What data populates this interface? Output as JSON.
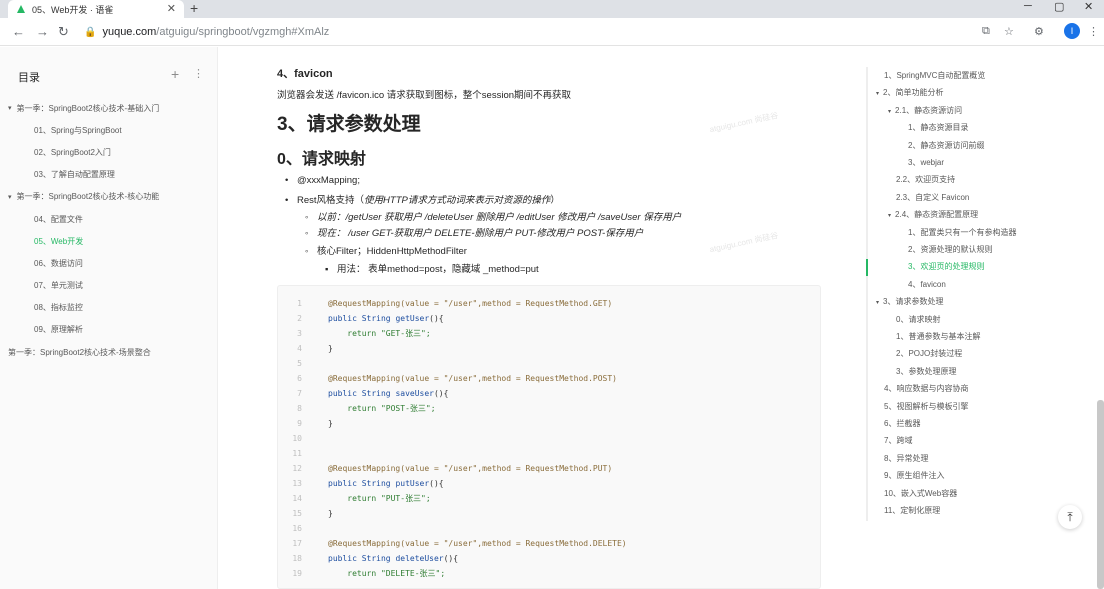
{
  "browser": {
    "tab_title": "05、Web开发 · 语雀",
    "tab_close": "✕",
    "new_tab": "+",
    "url_host": "yuque.com",
    "url_path": "/atguigu/springboot/vgzmgh#XmAlz",
    "profile_initial": "I"
  },
  "sidebar": {
    "title": "目录",
    "add": "+",
    "more": "⋮",
    "items": [
      {
        "label": "第一季：SpringBoot2核心技术-基础入门",
        "level": 1,
        "caret": "▾"
      },
      {
        "label": "01、Spring与SpringBoot",
        "level": 2
      },
      {
        "label": "02、SpringBoot2入门",
        "level": 2
      },
      {
        "label": "03、了解自动配置原理",
        "level": 2
      },
      {
        "label": "第一季：SpringBoot2核心技术-核心功能",
        "level": 1,
        "caret": "▾"
      },
      {
        "label": "04、配置文件",
        "level": 2
      },
      {
        "label": "05、Web开发",
        "level": 2,
        "active": true
      },
      {
        "label": "06、数据访问",
        "level": 2
      },
      {
        "label": "07、单元测试",
        "level": 2
      },
      {
        "label": "08、指标监控",
        "level": 2
      },
      {
        "label": "09、原理解析",
        "level": 2
      },
      {
        "label": "第一季：SpringBoot2核心技术-场景整合",
        "level": 1
      }
    ]
  },
  "content": {
    "favicon_heading": "4、favicon",
    "favicon_text": "浏览器会发送 /favicon.ico 请求获取到图标，整个session期间不再获取",
    "h2": "3、请求参数处理",
    "h3": "0、请求映射",
    "b1": "@xxxMapping;",
    "b2_prefix": "Rest风格支持（",
    "b2_italic": "使用HTTP请求方式动词来表示对资源的操作",
    "b2_suffix": "）",
    "s1": "以前：/getUser   获取用户     /deleteUser 删除用户    /editUser  修改用户       /saveUser 保存用户",
    "s2": "现在： /user    GET-获取用户    DELETE-删除用户     PUT-修改用户      POST-保存用户",
    "s3": "核心Filter；HiddenHttpMethodFilter",
    "ss1": "用法： 表单method=post，隐藏域 _method=put",
    "watermark": "atguigu.com 尚硅谷"
  },
  "code": [
    {
      "n": "1",
      "t": "ann",
      "text": "@RequestMapping(value = \"/user\",method = RequestMethod.GET)"
    },
    {
      "n": "2",
      "t": "sig",
      "kw": "public String ",
      "fn": "getUser",
      "rest": "(){"
    },
    {
      "n": "3",
      "t": "ret",
      "text": "    return \"GET-张三\";"
    },
    {
      "n": "4",
      "t": "pl",
      "text": "}"
    },
    {
      "n": "5",
      "t": "pl",
      "text": ""
    },
    {
      "n": "6",
      "t": "ann",
      "text": "@RequestMapping(value = \"/user\",method = RequestMethod.POST)"
    },
    {
      "n": "7",
      "t": "sig",
      "kw": "public String ",
      "fn": "saveUser",
      "rest": "(){"
    },
    {
      "n": "8",
      "t": "ret",
      "text": "    return \"POST-张三\";"
    },
    {
      "n": "9",
      "t": "pl",
      "text": "}"
    },
    {
      "n": "10",
      "t": "pl",
      "text": ""
    },
    {
      "n": "11",
      "t": "pl",
      "text": ""
    },
    {
      "n": "12",
      "t": "ann",
      "text": "@RequestMapping(value = \"/user\",method = RequestMethod.PUT)"
    },
    {
      "n": "13",
      "t": "sig",
      "kw": "public String ",
      "fn": "putUser",
      "rest": "(){"
    },
    {
      "n": "14",
      "t": "ret",
      "text": "    return \"PUT-张三\";"
    },
    {
      "n": "15",
      "t": "pl",
      "text": "}"
    },
    {
      "n": "16",
      "t": "pl",
      "text": ""
    },
    {
      "n": "17",
      "t": "ann",
      "text": "@RequestMapping(value = \"/user\",method = RequestMethod.DELETE)"
    },
    {
      "n": "18",
      "t": "sig",
      "kw": "public String ",
      "fn": "deleteUser",
      "rest": "(){"
    },
    {
      "n": "19",
      "t": "ret",
      "text": "    return \"DELETE-张三\";"
    }
  ],
  "toc": [
    {
      "label": "1、SpringMVC自动配置概览",
      "indent": 0
    },
    {
      "label": "2、简单功能分析",
      "indent": 0,
      "caret": "▾"
    },
    {
      "label": "2.1、静态资源访问",
      "indent": 1,
      "caret": "▾"
    },
    {
      "label": "1、静态资源目录",
      "indent": 2
    },
    {
      "label": "2、静态资源访问前缀",
      "indent": 2
    },
    {
      "label": "3、webjar",
      "indent": 2
    },
    {
      "label": "2.2、欢迎页支持",
      "indent": 1
    },
    {
      "label": "2.3、自定义 Favicon",
      "indent": 1
    },
    {
      "label": "2.4、静态资源配置原理",
      "indent": 1,
      "caret": "▾"
    },
    {
      "label": "1、配置类只有一个有参构造器",
      "indent": 2
    },
    {
      "label": "2、资源处理的默认规则",
      "indent": 2
    },
    {
      "label": "3、欢迎页的处理规则",
      "indent": 2,
      "active": true
    },
    {
      "label": "4、favicon",
      "indent": 2
    },
    {
      "label": "3、请求参数处理",
      "indent": 0,
      "caret": "▾"
    },
    {
      "label": "0、请求映射",
      "indent": 1
    },
    {
      "label": "1、普通参数与基本注解",
      "indent": 1
    },
    {
      "label": "2、POJO封装过程",
      "indent": 1
    },
    {
      "label": "3、参数处理原理",
      "indent": 1
    },
    {
      "label": "4、响应数据与内容协商",
      "indent": 0
    },
    {
      "label": "5、视图解析与模板引擎",
      "indent": 0
    },
    {
      "label": "6、拦截器",
      "indent": 0
    },
    {
      "label": "7、跨域",
      "indent": 0
    },
    {
      "label": "8、异常处理",
      "indent": 0
    },
    {
      "label": "9、原生组件注入",
      "indent": 0
    },
    {
      "label": "10、嵌入式Web容器",
      "indent": 0
    },
    {
      "label": "11、定制化原理",
      "indent": 0
    }
  ],
  "back_to_top": "⤒",
  "colors": {
    "accent": "#25b864"
  }
}
